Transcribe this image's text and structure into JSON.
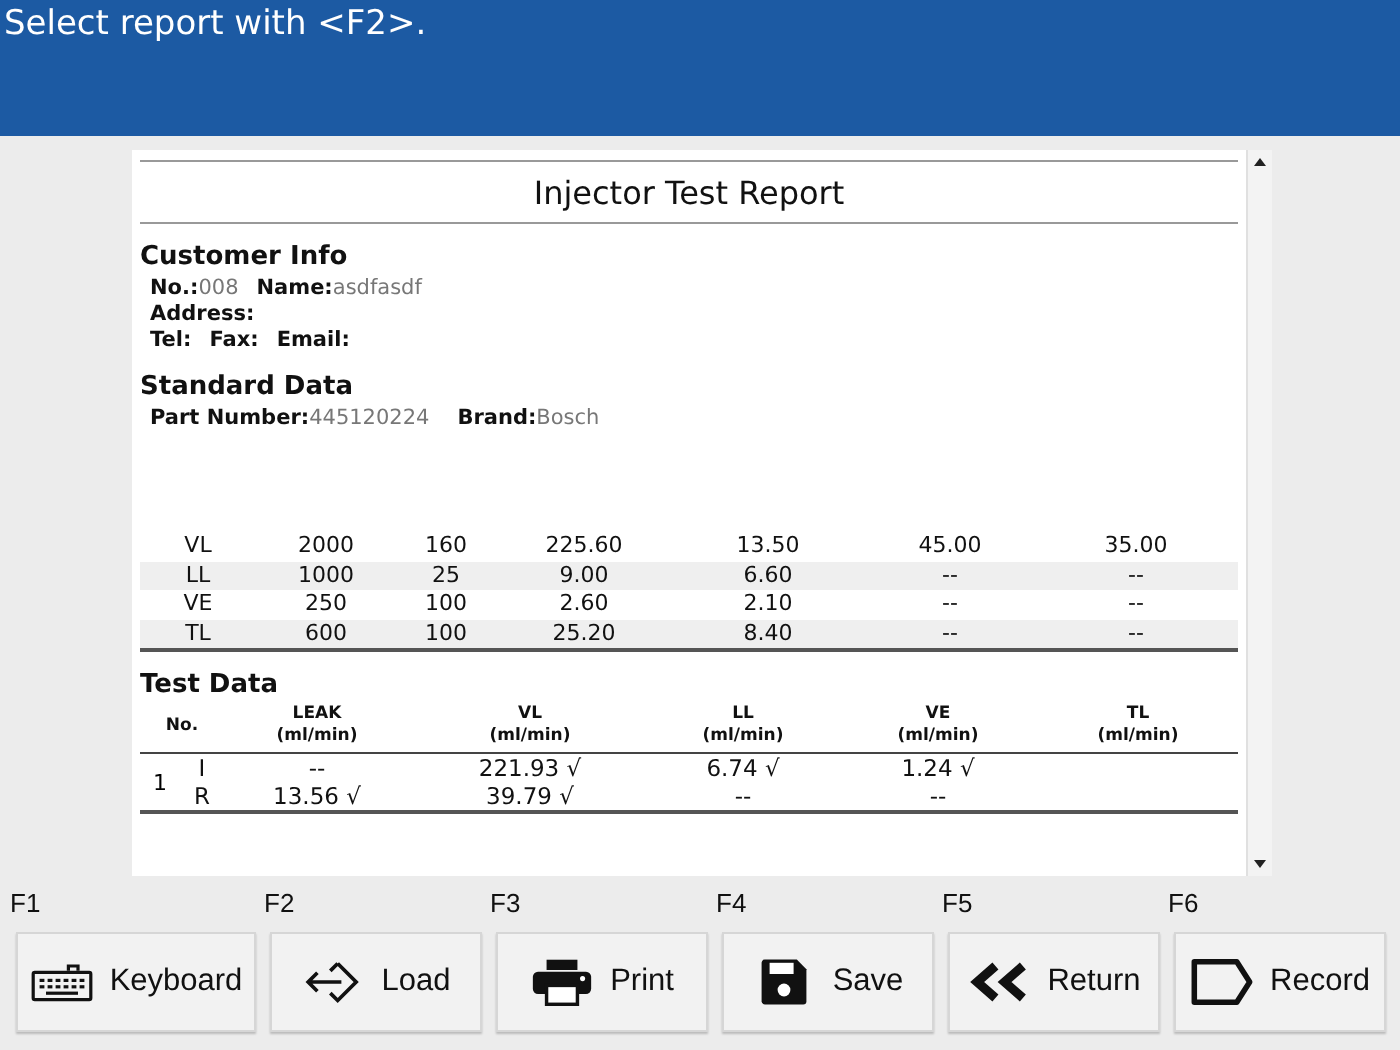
{
  "header": {
    "prompt": "Select report with <F2>."
  },
  "report": {
    "title": "Injector Test Report",
    "customer_info": {
      "heading": "Customer Info",
      "lines": [
        [
          {
            "label": "No.:",
            "value": "008"
          },
          {
            "label": "Name:",
            "value": "asdfasdf"
          }
        ],
        [
          {
            "label": "Address:"
          }
        ],
        [
          {
            "label": "Tel:"
          },
          {
            "label": "Fax:"
          },
          {
            "label": "Email:"
          }
        ]
      ]
    },
    "standard_data": {
      "heading": "Standard Data",
      "fields": [
        {
          "label": "Part Number:",
          "value": "445120224"
        },
        {
          "label": "Brand:",
          "value": "Bosch"
        }
      ],
      "rows": [
        [
          "VL",
          "2000",
          "160",
          "225.60",
          "13.50",
          "45.00",
          "35.00"
        ],
        [
          "LL",
          "1000",
          "25",
          "9.00",
          "6.60",
          "--",
          "--"
        ],
        [
          "VE",
          "250",
          "100",
          "2.60",
          "2.10",
          "--",
          "--"
        ],
        [
          "TL",
          "600",
          "100",
          "25.20",
          "8.40",
          "--",
          "--"
        ]
      ]
    },
    "test_data": {
      "heading": "Test Data",
      "no_label": "No.",
      "columns": [
        {
          "name": "LEAK",
          "unit": "(ml/min)"
        },
        {
          "name": "VL",
          "unit": "(ml/min)"
        },
        {
          "name": "LL",
          "unit": "(ml/min)"
        },
        {
          "name": "VE",
          "unit": "(ml/min)"
        },
        {
          "name": "TL",
          "unit": "(ml/min)"
        }
      ],
      "groups": [
        {
          "no": "1",
          "rows": [
            {
              "type": "I",
              "cells": [
                "--",
                "221.93 √",
                "6.74 √",
                "1.24 √"
              ]
            },
            {
              "type": "R",
              "cells": [
                "13.56 √",
                "39.79 √",
                "--",
                "--"
              ]
            }
          ]
        }
      ]
    }
  },
  "function_keys": [
    {
      "key": "F1",
      "label": "Keyboard",
      "kind": "keyboard"
    },
    {
      "key": "F2",
      "label": "Load",
      "kind": "load"
    },
    {
      "key": "F3",
      "label": "Print",
      "kind": "print"
    },
    {
      "key": "F4",
      "label": "Save",
      "kind": "save"
    },
    {
      "key": "F5",
      "label": "Return",
      "kind": "return"
    },
    {
      "key": "F6",
      "label": "Record",
      "kind": "record"
    }
  ]
}
